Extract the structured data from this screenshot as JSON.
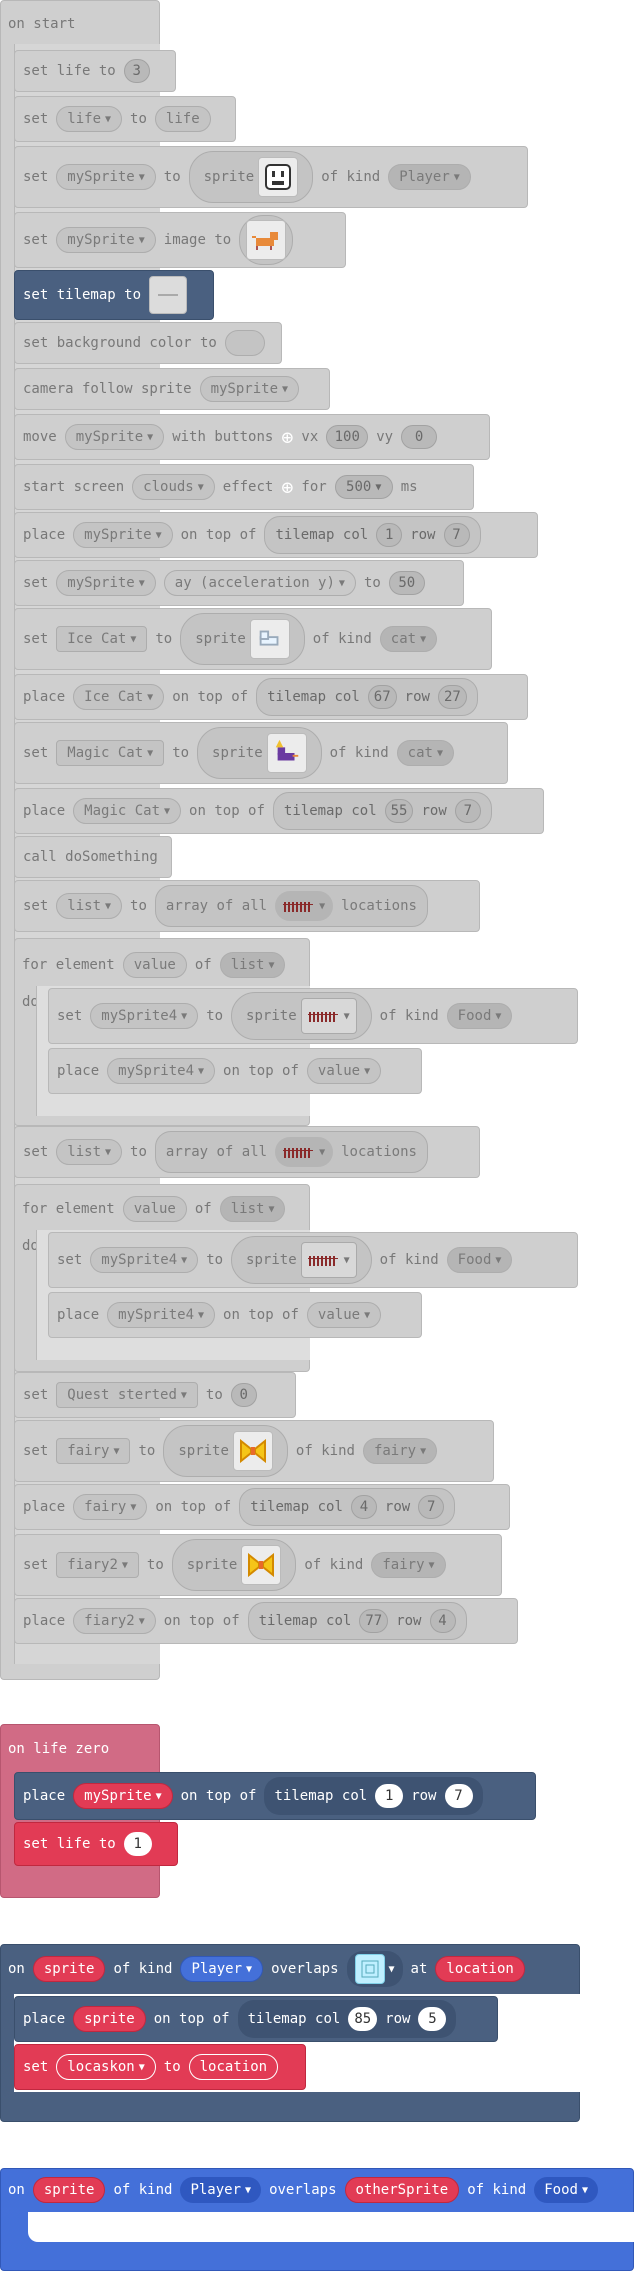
{
  "on_start": {
    "hat": "on start",
    "set_life": {
      "kw": "set life to",
      "value": "3"
    },
    "set_var_life": {
      "kw": "set",
      "var": "life",
      "to": "to",
      "value": "life"
    },
    "set_mysprite": {
      "kw": "set",
      "var": "mySprite",
      "to": "to",
      "sprite": "sprite",
      "of_kind": "of kind",
      "kind": "Player"
    },
    "set_image": {
      "kw": "set",
      "var": "mySprite",
      "image_to": "image to"
    },
    "set_tilemap": {
      "kw": "set tilemap to"
    },
    "set_bg": {
      "kw": "set background color to"
    },
    "camera": {
      "kw": "camera follow sprite",
      "var": "mySprite"
    },
    "move": {
      "kw": "move",
      "var": "mySprite",
      "with": "with buttons",
      "vx": "vx",
      "vx_val": "100",
      "vy": "vy",
      "vy_val": "0"
    },
    "start_screen": {
      "kw": "start screen",
      "effect_name": "clouds",
      "effect": "effect",
      "for": "for",
      "ms_val": "500",
      "ms": "ms"
    },
    "place1": {
      "kw": "place",
      "var": "mySprite",
      "on_top": "on top of",
      "tilemap": "tilemap col",
      "col": "1",
      "row": "row",
      "row_val": "7"
    },
    "set_ay": {
      "kw": "set",
      "var": "mySprite",
      "prop": "ay (acceleration y)",
      "to": "to",
      "value": "50"
    },
    "set_icecat": {
      "kw": "set",
      "var": "Ice Cat",
      "to": "to",
      "sprite": "sprite",
      "of_kind": "of kind",
      "kind": "cat"
    },
    "place_icecat": {
      "kw": "place",
      "var": "Ice Cat",
      "on_top": "on top of",
      "tilemap": "tilemap col",
      "col": "67",
      "row": "row",
      "row_val": "27"
    },
    "set_magiccat": {
      "kw": "set",
      "var": "Magic Cat",
      "to": "to",
      "sprite": "sprite",
      "of_kind": "of kind",
      "kind": "cat"
    },
    "place_magiccat": {
      "kw": "place",
      "var": "Magic Cat",
      "on_top": "on top of",
      "tilemap": "tilemap col",
      "col": "55",
      "row": "row",
      "row_val": "7"
    },
    "call": {
      "kw": "call doSomething"
    },
    "set_list1": {
      "kw": "set",
      "var": "list",
      "to": "to",
      "array": "array of all",
      "locations": "locations"
    },
    "for1": {
      "kw": "for element",
      "elem": "value",
      "of": "of",
      "list": "list",
      "do": "do"
    },
    "for1_set": {
      "kw": "set",
      "var": "mySprite4",
      "to": "to",
      "sprite": "sprite",
      "of_kind": "of kind",
      "kind": "Food"
    },
    "for1_place": {
      "kw": "place",
      "var": "mySprite4",
      "on_top": "on top of",
      "target": "value"
    },
    "set_list2": {
      "kw": "set",
      "var": "list",
      "to": "to",
      "array": "array of all",
      "locations": "locations"
    },
    "for2": {
      "kw": "for element",
      "elem": "value",
      "of": "of",
      "list": "list",
      "do": "do"
    },
    "for2_set": {
      "kw": "set",
      "var": "mySprite4",
      "to": "to",
      "sprite": "sprite",
      "of_kind": "of kind",
      "kind": "Food"
    },
    "for2_place": {
      "kw": "place",
      "var": "mySprite4",
      "on_top": "on top of",
      "target": "value"
    },
    "set_quest": {
      "kw": "set",
      "var": "Quest sterted",
      "to": "to",
      "value": "0"
    },
    "set_fairy": {
      "kw": "set",
      "var": "fairy",
      "to": "to",
      "sprite": "sprite",
      "of_kind": "of kind",
      "kind": "fairy"
    },
    "place_fairy": {
      "kw": "place",
      "var": "fairy",
      "on_top": "on top of",
      "tilemap": "tilemap col",
      "col": "4",
      "row": "row",
      "row_val": "7"
    },
    "set_fiary2": {
      "kw": "set",
      "var": "fiary2",
      "to": "to",
      "sprite": "sprite",
      "of_kind": "of kind",
      "kind": "fairy"
    },
    "place_fiary2": {
      "kw": "place",
      "var": "fiary2",
      "on_top": "on top of",
      "tilemap": "tilemap col",
      "col": "77",
      "row": "row",
      "row_val": "4"
    }
  },
  "on_life_zero": {
    "hat": "on life zero",
    "place": {
      "kw": "place",
      "var": "mySprite",
      "on_top": "on top of",
      "tilemap": "tilemap col",
      "col": "1",
      "row": "row",
      "row_val": "7"
    },
    "set_life": {
      "kw": "set life to",
      "value": "1"
    }
  },
  "overlap_location": {
    "on": "on",
    "sprite": "sprite",
    "of_kind": "of kind",
    "kind": "Player",
    "overlaps": "overlaps",
    "at": "at",
    "location": "location",
    "place": {
      "kw": "place",
      "var": "sprite",
      "on_top": "on top of",
      "tilemap": "tilemap col",
      "col": "85",
      "row": "row",
      "row_val": "5"
    },
    "set": {
      "kw": "set",
      "var": "locaskon",
      "to": "to",
      "value": "location"
    }
  },
  "overlap_sprite": {
    "on": "on",
    "sprite": "sprite",
    "of_kind": "of kind",
    "kind": "Player",
    "overlaps": "overlaps",
    "other": "otherSprite",
    "of_kind2": "of kind",
    "kind2": "Food"
  },
  "colors": {
    "gray": "#cfcfcf",
    "navy": "#4a6080",
    "red": "#e23b55",
    "blue": "#4470d9",
    "pink": "#d16b85"
  }
}
